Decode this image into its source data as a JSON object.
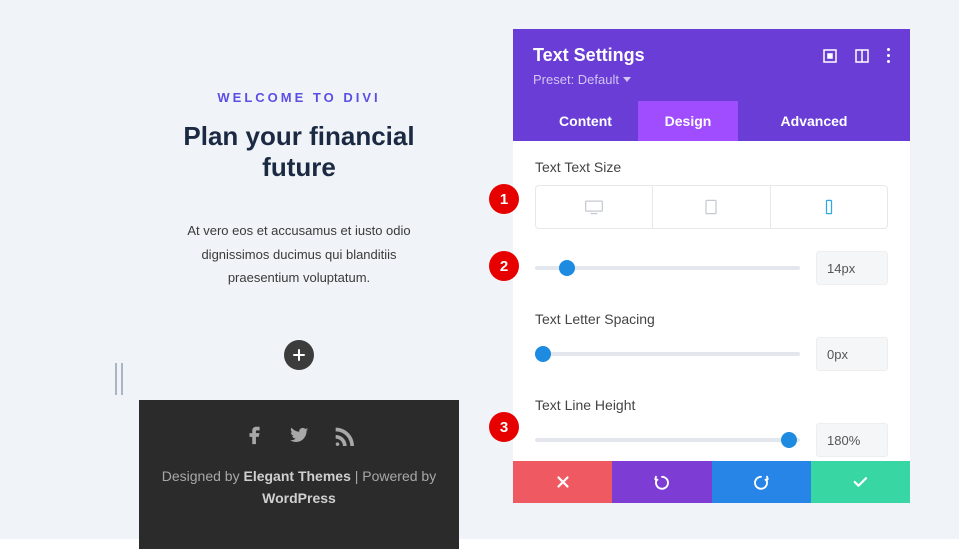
{
  "preview": {
    "eyebrow": "WELCOME TO DIVI",
    "title": "Plan your financial future",
    "body": "At vero eos et accusamus et iusto odio dignissimos ducimus qui blanditiis praesentium voluptatum.",
    "footer_pre": "Designed by ",
    "footer_theme": "Elegant Themes",
    "footer_mid": " | Powered by ",
    "footer_platform": "WordPress"
  },
  "panel": {
    "title": "Text Settings",
    "preset_label": "Preset: Default",
    "tabs": {
      "content": "Content",
      "design": "Design",
      "advanced": "Advanced"
    },
    "textSize": {
      "label": "Text Text Size",
      "value": "14px",
      "thumb_pct": 12
    },
    "letterSpacing": {
      "label": "Text Letter Spacing",
      "value": "0px",
      "thumb_pct": 3
    },
    "lineHeight": {
      "label": "Text Line Height",
      "value": "180%",
      "thumb_pct": 96
    }
  },
  "markers": {
    "m1": "1",
    "m2": "2",
    "m3": "3"
  }
}
